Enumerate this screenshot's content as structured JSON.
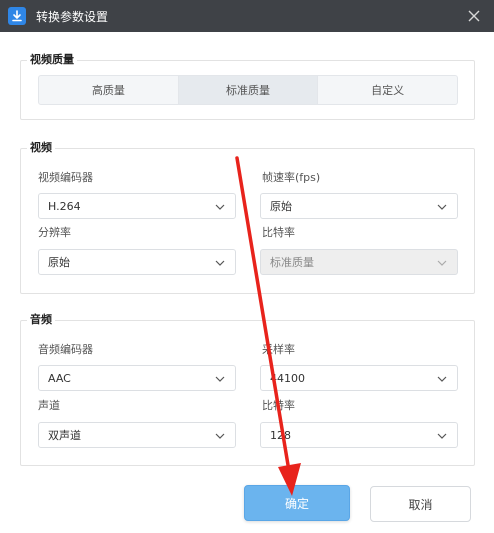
{
  "window": {
    "title": "转换参数设置",
    "icons": {
      "app": "download-icon",
      "close": "close-icon"
    }
  },
  "video_quality": {
    "legend": "视频质量",
    "options": [
      "高质量",
      "标准质量",
      "自定义"
    ],
    "selected": "标准质量"
  },
  "video": {
    "legend": "视频",
    "encoder": {
      "label": "视频编码器",
      "value": "H.264"
    },
    "framerate": {
      "label": "帧速率(fps)",
      "value": "原始"
    },
    "resolution": {
      "label": "分辨率",
      "value": "原始"
    },
    "bitrate": {
      "label": "比特率",
      "value": "标准质量",
      "disabled": true
    }
  },
  "audio": {
    "legend": "音频",
    "encoder": {
      "label": "音频编码器",
      "value": "AAC"
    },
    "samplerate": {
      "label": "采样率",
      "value": "44100"
    },
    "channel": {
      "label": "声道",
      "value": "双声道"
    },
    "bitrate": {
      "label": "比特率",
      "value": "128"
    }
  },
  "buttons": {
    "confirm": "确定",
    "cancel": "取消"
  },
  "colors": {
    "titlebar": "#3f4247",
    "primary": "#6bb4ee",
    "annotation_arrow": "#e8231c"
  }
}
